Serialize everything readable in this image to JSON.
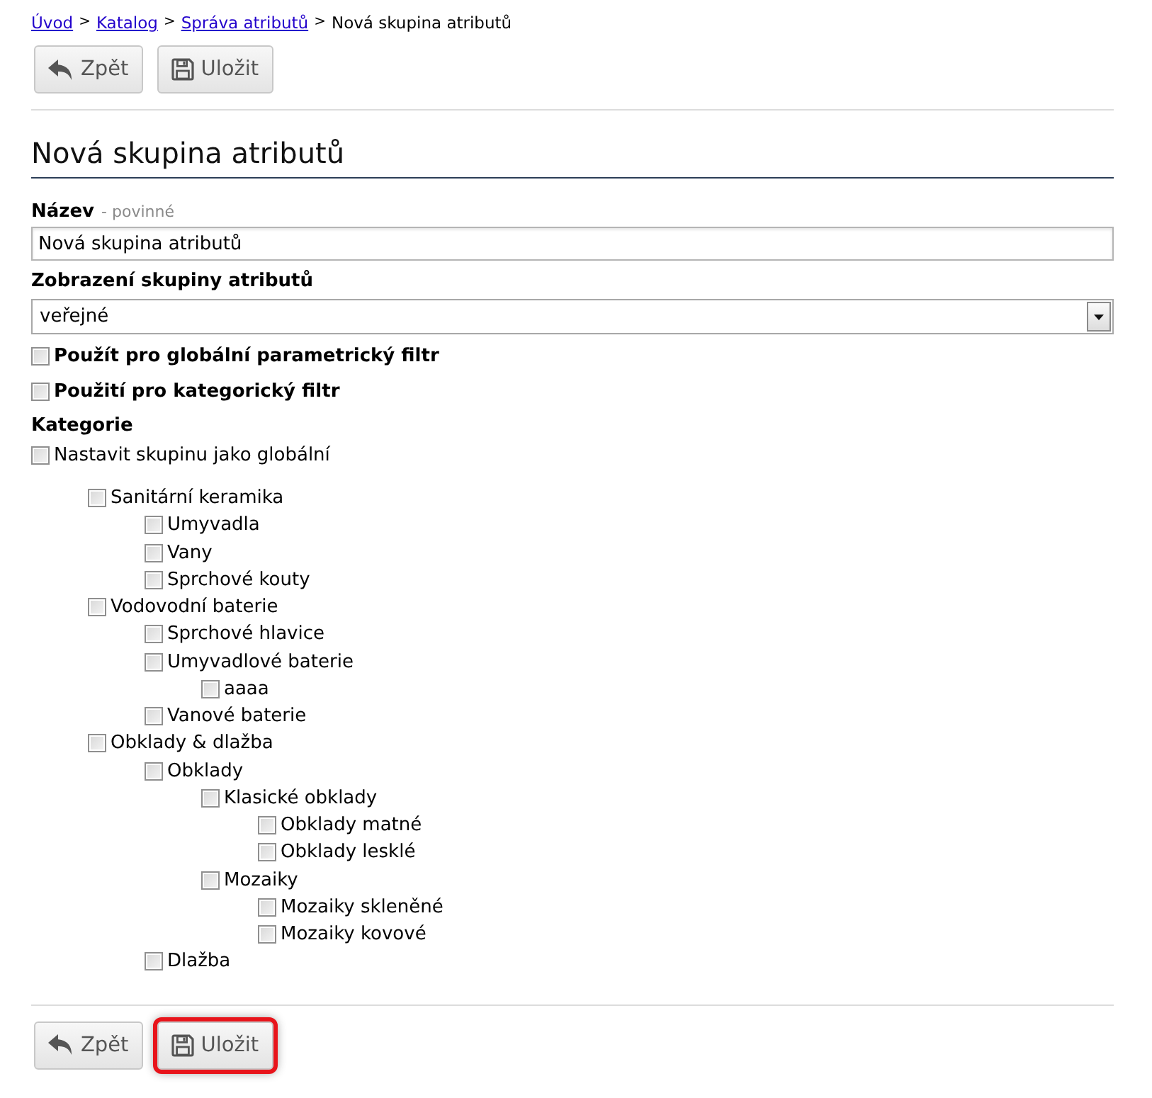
{
  "breadcrumb": {
    "separator": ">",
    "items": [
      {
        "label": "Úvod",
        "kind": "link"
      },
      {
        "label": "Katalog",
        "kind": "link"
      },
      {
        "label": "Správa atributů",
        "kind": "link"
      },
      {
        "label": "Nová skupina atributů",
        "kind": "current"
      }
    ]
  },
  "top_toolbar": [
    {
      "label": "Zpět",
      "kind": "back"
    },
    {
      "label": "Uložit",
      "kind": "save"
    }
  ],
  "heading": "Nová skupina atributů",
  "name_field": {
    "label": "Název",
    "hint": "- povinné",
    "value": "Nová skupina atributů"
  },
  "display_field": {
    "label": "Zobrazení skupiny atributů",
    "value": "veřejné"
  },
  "options": [
    {
      "label": "Použít pro globální parametrický filtr",
      "checked": false
    },
    {
      "label": "Použití pro kategorický filtr",
      "checked": false
    }
  ],
  "categories": {
    "label": "Kategorie",
    "global": {
      "label": "Nastavit skupinu jako globální",
      "checked": false
    },
    "tree": [
      {
        "label": "Sanitární keramika",
        "checked": false,
        "children": [
          {
            "label": "Umyvadla",
            "checked": false
          },
          {
            "label": "Vany",
            "checked": false
          },
          {
            "label": "Sprchové kouty",
            "checked": false
          }
        ]
      },
      {
        "label": "Vodovodní baterie",
        "checked": false,
        "children": [
          {
            "label": "Sprchové hlavice",
            "checked": false
          },
          {
            "label": "Umyvadlové baterie",
            "checked": false,
            "children": [
              {
                "label": "aaaa",
                "checked": false
              }
            ]
          },
          {
            "label": "Vanové baterie",
            "checked": false
          }
        ]
      },
      {
        "label": "Obklady & dlažba",
        "checked": false,
        "children": [
          {
            "label": "Obklady",
            "checked": false,
            "children": [
              {
                "label": "Klasické obklady",
                "checked": false,
                "children": [
                  {
                    "label": "Obklady matné",
                    "checked": false
                  },
                  {
                    "label": "Obklady lesklé",
                    "checked": false
                  }
                ]
              },
              {
                "label": "Mozaiky",
                "checked": false,
                "children": [
                  {
                    "label": "Mozaiky skleněné",
                    "checked": false
                  },
                  {
                    "label": "Mozaiky kovové",
                    "checked": false
                  }
                ]
              }
            ]
          },
          {
            "label": "Dlažba",
            "checked": false
          }
        ]
      }
    ]
  },
  "bottom_toolbar": [
    {
      "label": "Zpět",
      "kind": "back",
      "highlighted": false
    },
    {
      "label": "Uložit",
      "kind": "save",
      "highlighted": true
    }
  ]
}
